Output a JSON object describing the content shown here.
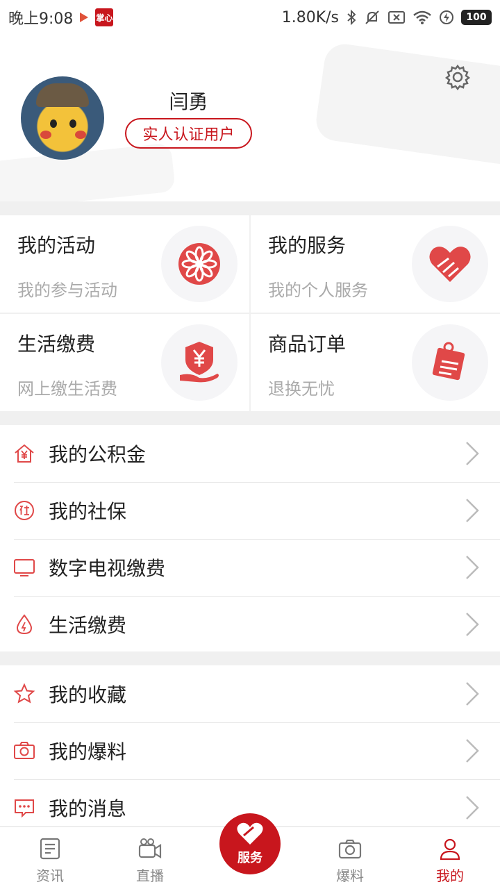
{
  "statusbar": {
    "time": "晚上9:08",
    "app_badge": "掌心",
    "speed": "1.80K/s",
    "battery": "100"
  },
  "profile": {
    "username": "闫勇",
    "badge": "实人认证用户"
  },
  "cards": [
    {
      "title": "我的活动",
      "subtitle": "我的参与活动",
      "icon": "flower-medallion-icon"
    },
    {
      "title": "我的服务",
      "subtitle": "我的个人服务",
      "icon": "heart-hand-icon"
    },
    {
      "title": "生活缴费",
      "subtitle": "网上缴生活费",
      "icon": "yuan-shield-hand-icon"
    },
    {
      "title": "商品订单",
      "subtitle": "退换无忧",
      "icon": "clipboard-order-icon"
    }
  ],
  "list1": [
    {
      "label": "我的公积金",
      "icon": "house-yuan-icon"
    },
    {
      "label": "我的社保",
      "icon": "social-security-icon"
    },
    {
      "label": "数字电视缴费",
      "icon": "tv-icon"
    },
    {
      "label": "生活缴费",
      "icon": "drop-bolt-icon"
    }
  ],
  "list2": [
    {
      "label": "我的收藏",
      "icon": "star-icon"
    },
    {
      "label": "我的爆料",
      "icon": "camera-icon"
    },
    {
      "label": "我的消息",
      "icon": "message-icon"
    }
  ],
  "tabs": [
    {
      "label": "资讯",
      "icon": "news-icon"
    },
    {
      "label": "直播",
      "icon": "video-camera-icon"
    },
    {
      "label": "服务",
      "icon": "heart-pill-icon"
    },
    {
      "label": "爆料",
      "icon": "camera-icon"
    },
    {
      "label": "我的",
      "icon": "person-icon"
    }
  ],
  "colors": {
    "accent": "#c8161d",
    "icon_red": "#e04848",
    "background": "#f0f0f0"
  }
}
